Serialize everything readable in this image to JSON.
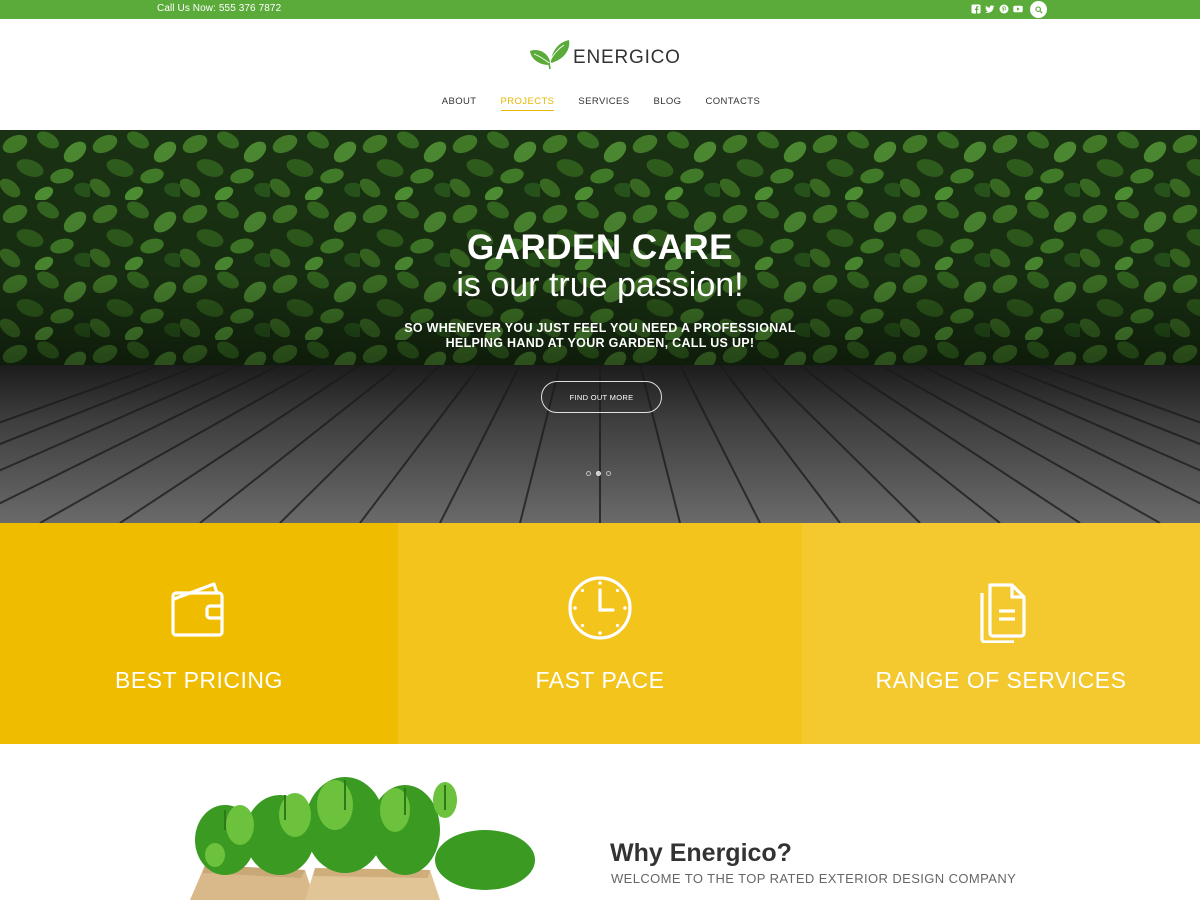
{
  "topbar": {
    "phone": "Call Us Now: 555 376 7872",
    "social": [
      "facebook-icon",
      "twitter-icon",
      "pinterest-icon",
      "youtube-icon"
    ],
    "search_icon": "search-icon"
  },
  "header": {
    "logo_text": "ENERGICO",
    "nav": [
      {
        "label": "ABOUT",
        "active": false
      },
      {
        "label": "PROJECTS",
        "active": true
      },
      {
        "label": "SERVICES",
        "active": false
      },
      {
        "label": "BLOG",
        "active": false
      },
      {
        "label": "CONTACTS",
        "active": false
      }
    ]
  },
  "hero": {
    "title": "GARDEN CARE",
    "subtitle": "is our true passion!",
    "desc_line1": "SO WHENEVER YOU JUST FEEL YOU NEED A PROFESSIONAL",
    "desc_line2": "HELPING HAND AT YOUR GARDEN, CALL US UP!",
    "button": "FIND OUT MORE",
    "slides": 3,
    "active_slide": 2
  },
  "features": [
    {
      "label": "BEST PRICING",
      "icon": "wallet-icon",
      "color": "#f0bc00"
    },
    {
      "label": "FAST PACE",
      "icon": "clock-icon",
      "color": "#f2c41c"
    },
    {
      "label": "RANGE OF SERVICES",
      "icon": "documents-icon",
      "color": "#f4c930"
    }
  ],
  "about": {
    "title": "Why Energico?",
    "subtitle": "WELCOME TO THE TOP RATED EXTERIOR DESIGN COMPANY"
  },
  "colors": {
    "brand_green": "#5bab3a",
    "accent_yellow": "#e6b800"
  }
}
